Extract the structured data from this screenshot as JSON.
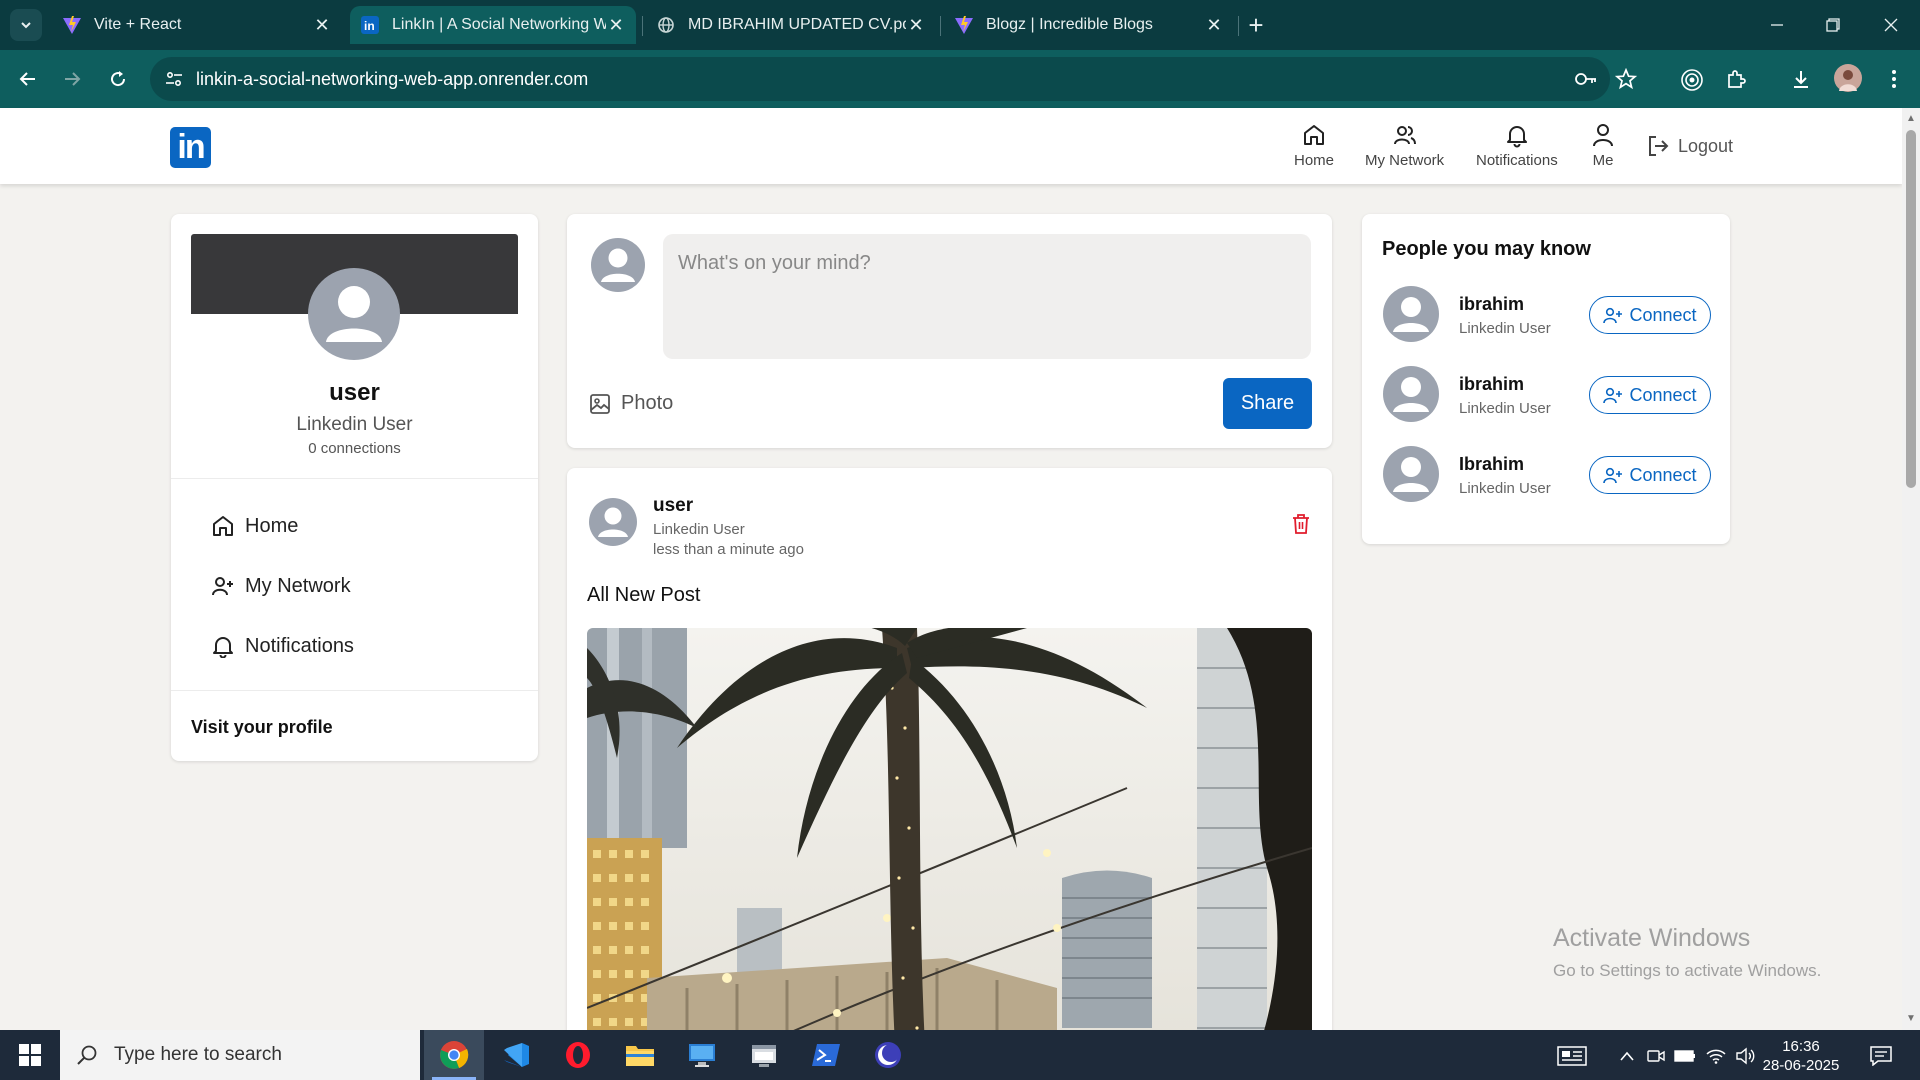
{
  "browser": {
    "tabs": [
      {
        "title": "Vite + React",
        "active": false
      },
      {
        "title": "LinkIn | A Social Networking We",
        "active": true
      },
      {
        "title": "MD IBRAHIM UPDATED CV.pdf",
        "active": false
      },
      {
        "title": "Blogz | Incredible Blogs",
        "active": false
      }
    ],
    "url": "linkin-a-social-networking-web-app.onrender.com"
  },
  "app": {
    "logo_text": "in",
    "nav": [
      {
        "label": "Home",
        "icon": "home-icon"
      },
      {
        "label": "My Network",
        "icon": "people-icon"
      },
      {
        "label": "Notifications",
        "icon": "bell-icon"
      },
      {
        "label": "Me",
        "icon": "user-icon"
      }
    ],
    "logout_label": "Logout",
    "colors": {
      "brand": "#0a66c2",
      "delete": "#e11d2d"
    }
  },
  "profile": {
    "name": "user",
    "title": "Linkedin User",
    "connections": "0 connections",
    "links": [
      {
        "label": "Home",
        "icon": "home-icon"
      },
      {
        "label": "My Network",
        "icon": "add-user-icon"
      },
      {
        "label": "Notifications",
        "icon": "bell-icon"
      }
    ],
    "visit_profile": "Visit your profile"
  },
  "composer": {
    "placeholder": "What's on your mind?",
    "photo_label": "Photo",
    "share_label": "Share"
  },
  "post": {
    "author": "user",
    "author_title": "Linkedin User",
    "time": "less than a minute ago",
    "text": "All New Post"
  },
  "people": {
    "heading": "People you may know",
    "connect_label": "Connect",
    "items": [
      {
        "name": "ibrahim",
        "title": "Linkedin User"
      },
      {
        "name": "ibrahim",
        "title": "Linkedin User"
      },
      {
        "name": "Ibrahim",
        "title": "Linkedin User"
      }
    ]
  },
  "watermark": {
    "line1": "Activate Windows",
    "line2": "Go to Settings to activate Windows."
  },
  "taskbar": {
    "search_placeholder": "Type here to search",
    "time": "16:36",
    "date": "28-06-2025"
  }
}
